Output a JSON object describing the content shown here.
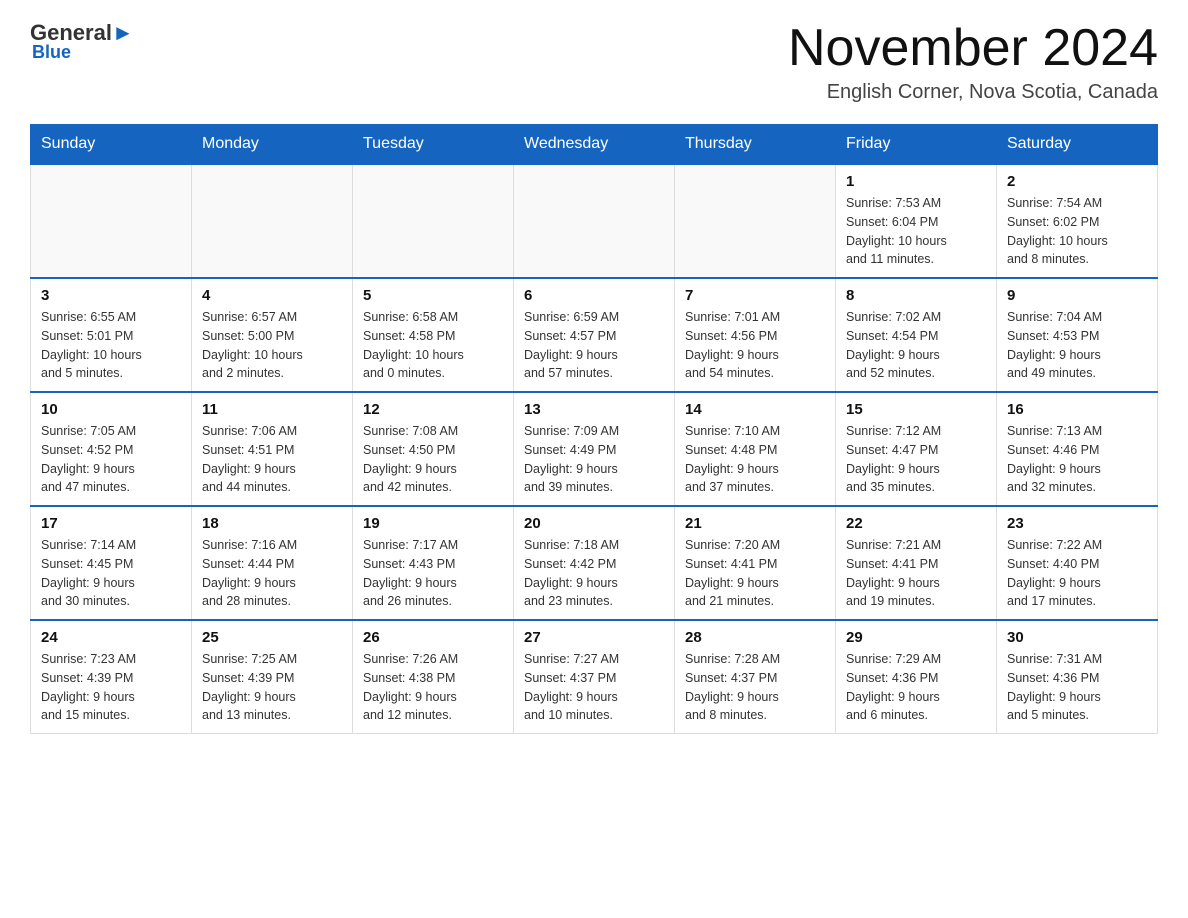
{
  "header": {
    "logo_general": "General",
    "logo_blue": "Blue",
    "month_title": "November 2024",
    "location": "English Corner, Nova Scotia, Canada"
  },
  "weekdays": [
    "Sunday",
    "Monday",
    "Tuesday",
    "Wednesday",
    "Thursday",
    "Friday",
    "Saturday"
  ],
  "weeks": [
    [
      {
        "day": "",
        "info": ""
      },
      {
        "day": "",
        "info": ""
      },
      {
        "day": "",
        "info": ""
      },
      {
        "day": "",
        "info": ""
      },
      {
        "day": "",
        "info": ""
      },
      {
        "day": "1",
        "info": "Sunrise: 7:53 AM\nSunset: 6:04 PM\nDaylight: 10 hours\nand 11 minutes."
      },
      {
        "day": "2",
        "info": "Sunrise: 7:54 AM\nSunset: 6:02 PM\nDaylight: 10 hours\nand 8 minutes."
      }
    ],
    [
      {
        "day": "3",
        "info": "Sunrise: 6:55 AM\nSunset: 5:01 PM\nDaylight: 10 hours\nand 5 minutes."
      },
      {
        "day": "4",
        "info": "Sunrise: 6:57 AM\nSunset: 5:00 PM\nDaylight: 10 hours\nand 2 minutes."
      },
      {
        "day": "5",
        "info": "Sunrise: 6:58 AM\nSunset: 4:58 PM\nDaylight: 10 hours\nand 0 minutes."
      },
      {
        "day": "6",
        "info": "Sunrise: 6:59 AM\nSunset: 4:57 PM\nDaylight: 9 hours\nand 57 minutes."
      },
      {
        "day": "7",
        "info": "Sunrise: 7:01 AM\nSunset: 4:56 PM\nDaylight: 9 hours\nand 54 minutes."
      },
      {
        "day": "8",
        "info": "Sunrise: 7:02 AM\nSunset: 4:54 PM\nDaylight: 9 hours\nand 52 minutes."
      },
      {
        "day": "9",
        "info": "Sunrise: 7:04 AM\nSunset: 4:53 PM\nDaylight: 9 hours\nand 49 minutes."
      }
    ],
    [
      {
        "day": "10",
        "info": "Sunrise: 7:05 AM\nSunset: 4:52 PM\nDaylight: 9 hours\nand 47 minutes."
      },
      {
        "day": "11",
        "info": "Sunrise: 7:06 AM\nSunset: 4:51 PM\nDaylight: 9 hours\nand 44 minutes."
      },
      {
        "day": "12",
        "info": "Sunrise: 7:08 AM\nSunset: 4:50 PM\nDaylight: 9 hours\nand 42 minutes."
      },
      {
        "day": "13",
        "info": "Sunrise: 7:09 AM\nSunset: 4:49 PM\nDaylight: 9 hours\nand 39 minutes."
      },
      {
        "day": "14",
        "info": "Sunrise: 7:10 AM\nSunset: 4:48 PM\nDaylight: 9 hours\nand 37 minutes."
      },
      {
        "day": "15",
        "info": "Sunrise: 7:12 AM\nSunset: 4:47 PM\nDaylight: 9 hours\nand 35 minutes."
      },
      {
        "day": "16",
        "info": "Sunrise: 7:13 AM\nSunset: 4:46 PM\nDaylight: 9 hours\nand 32 minutes."
      }
    ],
    [
      {
        "day": "17",
        "info": "Sunrise: 7:14 AM\nSunset: 4:45 PM\nDaylight: 9 hours\nand 30 minutes."
      },
      {
        "day": "18",
        "info": "Sunrise: 7:16 AM\nSunset: 4:44 PM\nDaylight: 9 hours\nand 28 minutes."
      },
      {
        "day": "19",
        "info": "Sunrise: 7:17 AM\nSunset: 4:43 PM\nDaylight: 9 hours\nand 26 minutes."
      },
      {
        "day": "20",
        "info": "Sunrise: 7:18 AM\nSunset: 4:42 PM\nDaylight: 9 hours\nand 23 minutes."
      },
      {
        "day": "21",
        "info": "Sunrise: 7:20 AM\nSunset: 4:41 PM\nDaylight: 9 hours\nand 21 minutes."
      },
      {
        "day": "22",
        "info": "Sunrise: 7:21 AM\nSunset: 4:41 PM\nDaylight: 9 hours\nand 19 minutes."
      },
      {
        "day": "23",
        "info": "Sunrise: 7:22 AM\nSunset: 4:40 PM\nDaylight: 9 hours\nand 17 minutes."
      }
    ],
    [
      {
        "day": "24",
        "info": "Sunrise: 7:23 AM\nSunset: 4:39 PM\nDaylight: 9 hours\nand 15 minutes."
      },
      {
        "day": "25",
        "info": "Sunrise: 7:25 AM\nSunset: 4:39 PM\nDaylight: 9 hours\nand 13 minutes."
      },
      {
        "day": "26",
        "info": "Sunrise: 7:26 AM\nSunset: 4:38 PM\nDaylight: 9 hours\nand 12 minutes."
      },
      {
        "day": "27",
        "info": "Sunrise: 7:27 AM\nSunset: 4:37 PM\nDaylight: 9 hours\nand 10 minutes."
      },
      {
        "day": "28",
        "info": "Sunrise: 7:28 AM\nSunset: 4:37 PM\nDaylight: 9 hours\nand 8 minutes."
      },
      {
        "day": "29",
        "info": "Sunrise: 7:29 AM\nSunset: 4:36 PM\nDaylight: 9 hours\nand 6 minutes."
      },
      {
        "day": "30",
        "info": "Sunrise: 7:31 AM\nSunset: 4:36 PM\nDaylight: 9 hours\nand 5 minutes."
      }
    ]
  ]
}
